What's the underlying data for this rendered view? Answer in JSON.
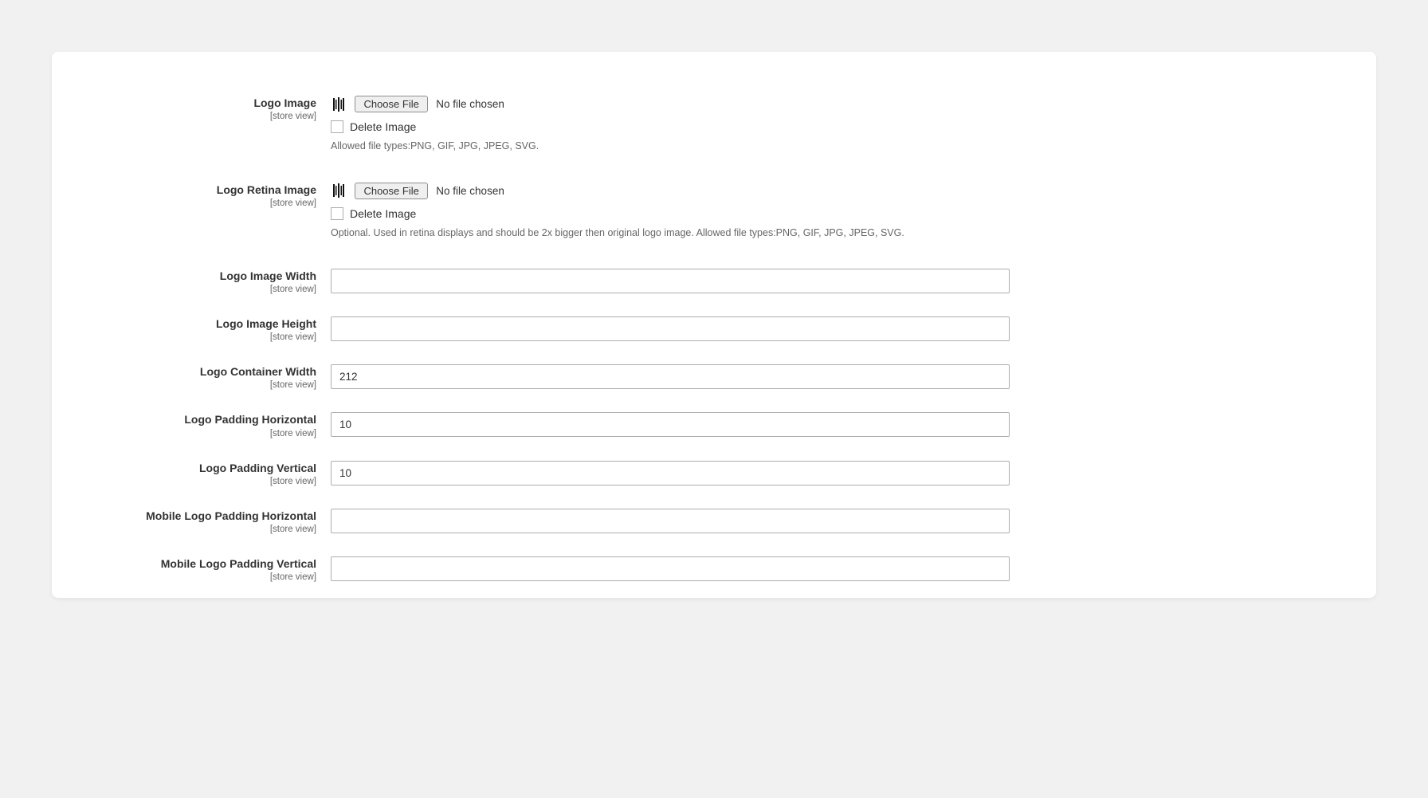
{
  "scope_label": "[store view]",
  "fields": {
    "logo_image": {
      "label": "Logo Image",
      "choose_btn": "Choose File",
      "file_status": "No file chosen",
      "delete_label": "Delete Image",
      "note": "Allowed file types:PNG, GIF, JPG, JPEG, SVG."
    },
    "logo_retina": {
      "label": "Logo Retina Image",
      "choose_btn": "Choose File",
      "file_status": "No file chosen",
      "delete_label": "Delete Image",
      "note": "Optional. Used in retina displays and should be 2x bigger then original logo image. Allowed file types:PNG, GIF, JPG, JPEG, SVG."
    },
    "logo_width": {
      "label": "Logo Image Width",
      "value": ""
    },
    "logo_height": {
      "label": "Logo Image Height",
      "value": ""
    },
    "container_width": {
      "label": "Logo Container Width",
      "value": "212"
    },
    "pad_h": {
      "label": "Logo Padding Horizontal",
      "value": "10"
    },
    "pad_v": {
      "label": "Logo Padding Vertical",
      "value": "10"
    },
    "mobile_pad_h": {
      "label": "Mobile Logo Padding Horizontal",
      "value": ""
    },
    "mobile_pad_v": {
      "label": "Mobile Logo Padding Vertical",
      "value": ""
    }
  }
}
